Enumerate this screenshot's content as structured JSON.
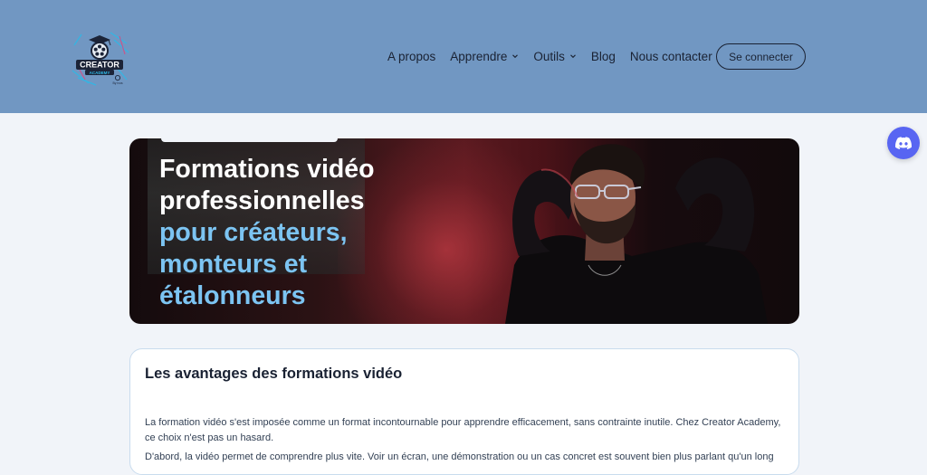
{
  "header": {
    "logo": {
      "brand_text": "CREATOR",
      "sub_text": "ACADEMY",
      "tag_text": "By Ivos"
    },
    "nav": {
      "items": [
        {
          "label": "A propos",
          "has_dropdown": false
        },
        {
          "label": "Apprendre",
          "has_dropdown": true
        },
        {
          "label": "Outils",
          "has_dropdown": true
        },
        {
          "label": "Blog",
          "has_dropdown": false
        },
        {
          "label": "Nous contacter",
          "has_dropdown": false
        }
      ]
    },
    "login_label": "Se connecter"
  },
  "discord": {
    "icon": "discord-icon"
  },
  "hero": {
    "title_line1": "Formations vidéo",
    "title_line2": "professionnelles",
    "title_line3": "pour créateurs,",
    "title_line4": "monteurs et",
    "title_line5": "étalonneurs"
  },
  "content": {
    "heading": "Les avantages des formations vidéo",
    "paragraph1": "La formation vidéo s'est imposée comme un format incontournable pour apprendre efficacement, sans contrainte inutile. Chez Creator Academy, ce choix n'est pas un hasard.",
    "paragraph2": "D'abord, la vidéo permet de comprendre plus vite. Voir un écran, une démonstration ou un cas concret est souvent bien plus parlant qu'un long"
  },
  "colors": {
    "header_bg": "#7197c2",
    "page_bg": "#f1f4f9",
    "accent_blue": "#7cc4f2",
    "discord": "#5865f2"
  }
}
